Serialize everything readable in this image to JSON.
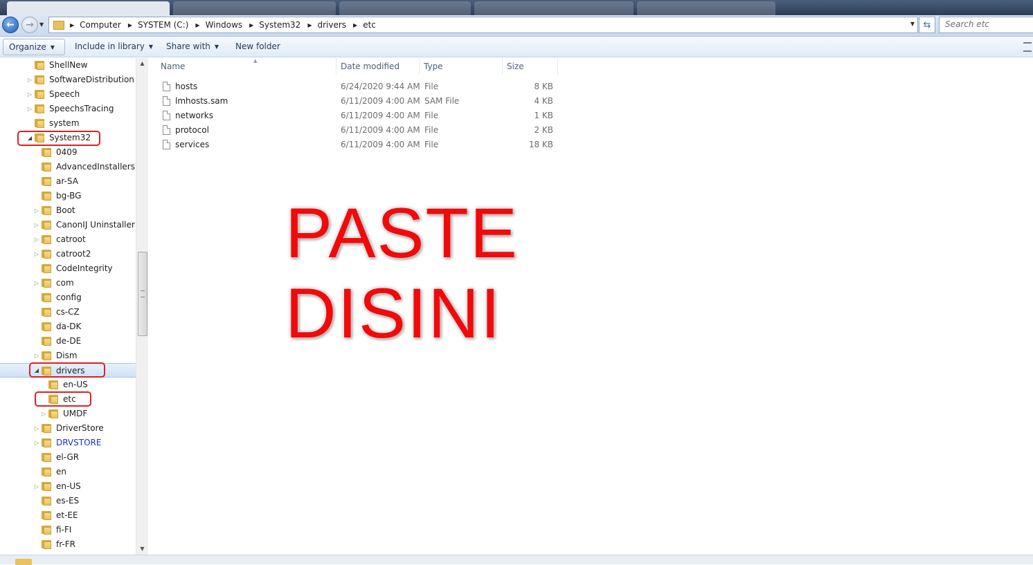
{
  "browser_tabs": {
    "note": ""
  },
  "address_bar": {
    "breadcrumbs": [
      "Computer",
      "SYSTEM (C:)",
      "Windows",
      "System32",
      "drivers",
      "etc"
    ]
  },
  "search": {
    "placeholder": "Search etc"
  },
  "toolbar": {
    "organize": "Organize",
    "include_in_library": "Include in library",
    "share_with": "Share with",
    "new_folder": "New folder"
  },
  "nav_tree": [
    {
      "label": "ShellNew",
      "expander": "none",
      "level": 0
    },
    {
      "label": "SoftwareDistribution",
      "expander": "closed",
      "level": 0
    },
    {
      "label": "Speech",
      "expander": "closed",
      "level": 0
    },
    {
      "label": "SpeechsTracing",
      "expander": "closed",
      "level": 0
    },
    {
      "label": "system",
      "expander": "none",
      "level": 0
    },
    {
      "label": "System32",
      "expander": "open",
      "level": 0
    },
    {
      "label": "0409",
      "expander": "none",
      "level": 1
    },
    {
      "label": "AdvancedInstallers",
      "expander": "none",
      "level": 1
    },
    {
      "label": "ar-SA",
      "expander": "none",
      "level": 1
    },
    {
      "label": "bg-BG",
      "expander": "none",
      "level": 1
    },
    {
      "label": "Boot",
      "expander": "closed",
      "level": 1
    },
    {
      "label": "CanonIJ Uninstaller In",
      "expander": "closed",
      "level": 1
    },
    {
      "label": "catroot",
      "expander": "closed",
      "level": 1
    },
    {
      "label": "catroot2",
      "expander": "closed",
      "level": 1
    },
    {
      "label": "CodeIntegrity",
      "expander": "none",
      "level": 1
    },
    {
      "label": "com",
      "expander": "closed",
      "level": 1
    },
    {
      "label": "config",
      "expander": "none",
      "level": 1
    },
    {
      "label": "cs-CZ",
      "expander": "none",
      "level": 1
    },
    {
      "label": "da-DK",
      "expander": "none",
      "level": 1
    },
    {
      "label": "de-DE",
      "expander": "none",
      "level": 1
    },
    {
      "label": "Dism",
      "expander": "closed",
      "level": 1
    },
    {
      "label": "drivers",
      "expander": "open",
      "level": 1,
      "selected": true
    },
    {
      "label": "en-US",
      "expander": "none",
      "level": 2
    },
    {
      "label": "etc",
      "expander": "none",
      "level": 2
    },
    {
      "label": "UMDF",
      "expander": "closed",
      "level": 2
    },
    {
      "label": "DriverStore",
      "expander": "closed",
      "level": 1
    },
    {
      "label": "DRVSTORE",
      "expander": "closed",
      "level": 1,
      "blue": true
    },
    {
      "label": "el-GR",
      "expander": "none",
      "level": 1
    },
    {
      "label": "en",
      "expander": "none",
      "level": 1
    },
    {
      "label": "en-US",
      "expander": "closed",
      "level": 1
    },
    {
      "label": "es-ES",
      "expander": "none",
      "level": 1
    },
    {
      "label": "et-EE",
      "expander": "none",
      "level": 1
    },
    {
      "label": "fi-FI",
      "expander": "none",
      "level": 1
    },
    {
      "label": "fr-FR",
      "expander": "none",
      "level": 1
    }
  ],
  "columns": {
    "name": "Name",
    "date_modified": "Date modified",
    "type": "Type",
    "size": "Size"
  },
  "files": [
    {
      "name": "hosts",
      "date": "6/24/2020 9:44 AM",
      "type": "File",
      "size": "8 KB"
    },
    {
      "name": "lmhosts.sam",
      "date": "6/11/2009 4:00 AM",
      "type": "SAM File",
      "size": "4 KB"
    },
    {
      "name": "networks",
      "date": "6/11/2009 4:00 AM",
      "type": "File",
      "size": "1 KB"
    },
    {
      "name": "protocol",
      "date": "6/11/2009 4:00 AM",
      "type": "File",
      "size": "2 KB"
    },
    {
      "name": "services",
      "date": "6/11/2009 4:00 AM",
      "type": "File",
      "size": "18 KB"
    }
  ],
  "overlay": {
    "line1": "PASTE",
    "line2": "DISINI",
    "color": "#f00a0a"
  },
  "colors": {
    "highlight": "#e31d1d",
    "link_blue": "#1a2fd6"
  }
}
